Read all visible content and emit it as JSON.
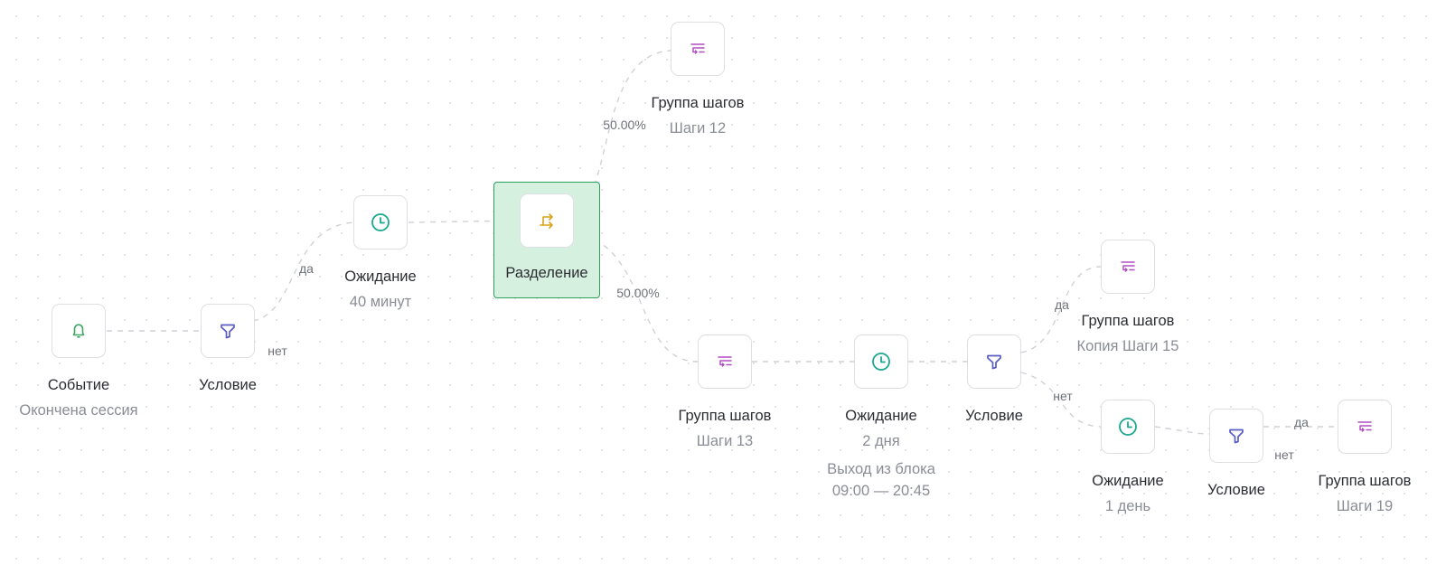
{
  "colors": {
    "event": "#3fa564",
    "condition": "#5a5cc4",
    "wait": "#1aa88f",
    "split": "#d9a21b",
    "group": "#b04fc0",
    "selected_border": "#2f9e5a",
    "selected_fill": "#d6f0df"
  },
  "nodes": [
    {
      "id": "n1",
      "type": "event",
      "icon": "bell-icon",
      "title": "Событие",
      "subtitle": "Окончена сессия"
    },
    {
      "id": "n2",
      "type": "condition",
      "icon": "funnel-icon",
      "title": "Условие"
    },
    {
      "id": "n3",
      "type": "wait",
      "icon": "clock-icon",
      "title": "Ожидание",
      "subtitle": "40 минут"
    },
    {
      "id": "n4",
      "type": "split",
      "icon": "split-arrows-icon",
      "title": "Разделение",
      "selected": true
    },
    {
      "id": "n5",
      "type": "group",
      "icon": "step-group-icon",
      "title": "Группа шагов",
      "subtitle": "Шаги 12"
    },
    {
      "id": "n6",
      "type": "group",
      "icon": "step-group-icon",
      "title": "Группа шагов",
      "subtitle": "Шаги 13"
    },
    {
      "id": "n7",
      "type": "wait",
      "icon": "clock-icon",
      "title": "Ожидание",
      "subtitle": "2 дня",
      "extra": [
        "Выход из блока",
        "09:00 — 20:45"
      ]
    },
    {
      "id": "n8",
      "type": "condition",
      "icon": "funnel-icon",
      "title": "Условие"
    },
    {
      "id": "n9",
      "type": "group",
      "icon": "step-group-icon",
      "title": "Группа шагов",
      "subtitle": "Копия Шаги 15"
    },
    {
      "id": "n10",
      "type": "wait",
      "icon": "clock-icon",
      "title": "Ожидание",
      "subtitle": "1 день"
    },
    {
      "id": "n11",
      "type": "condition",
      "icon": "funnel-icon",
      "title": "Условие"
    },
    {
      "id": "n12",
      "type": "group",
      "icon": "step-group-icon",
      "title": "Группа шагов",
      "subtitle": "Шаги 19"
    }
  ],
  "edges": [
    {
      "from": "n1",
      "to": "n2"
    },
    {
      "from": "n2",
      "to": "n3",
      "label": "да"
    },
    {
      "from": "n2",
      "label": "нет"
    },
    {
      "from": "n3",
      "to": "n4"
    },
    {
      "from": "n4",
      "to": "n5",
      "label": "50.00%"
    },
    {
      "from": "n4",
      "to": "n6",
      "label": "50.00%"
    },
    {
      "from": "n6",
      "to": "n7"
    },
    {
      "from": "n7",
      "to": "n8"
    },
    {
      "from": "n8",
      "to": "n9",
      "label": "да"
    },
    {
      "from": "n8",
      "to": "n10",
      "label": "нет"
    },
    {
      "from": "n10",
      "to": "n11"
    },
    {
      "from": "n11",
      "to": "n12",
      "label": "да"
    },
    {
      "from": "n11",
      "label": "нет"
    }
  ]
}
